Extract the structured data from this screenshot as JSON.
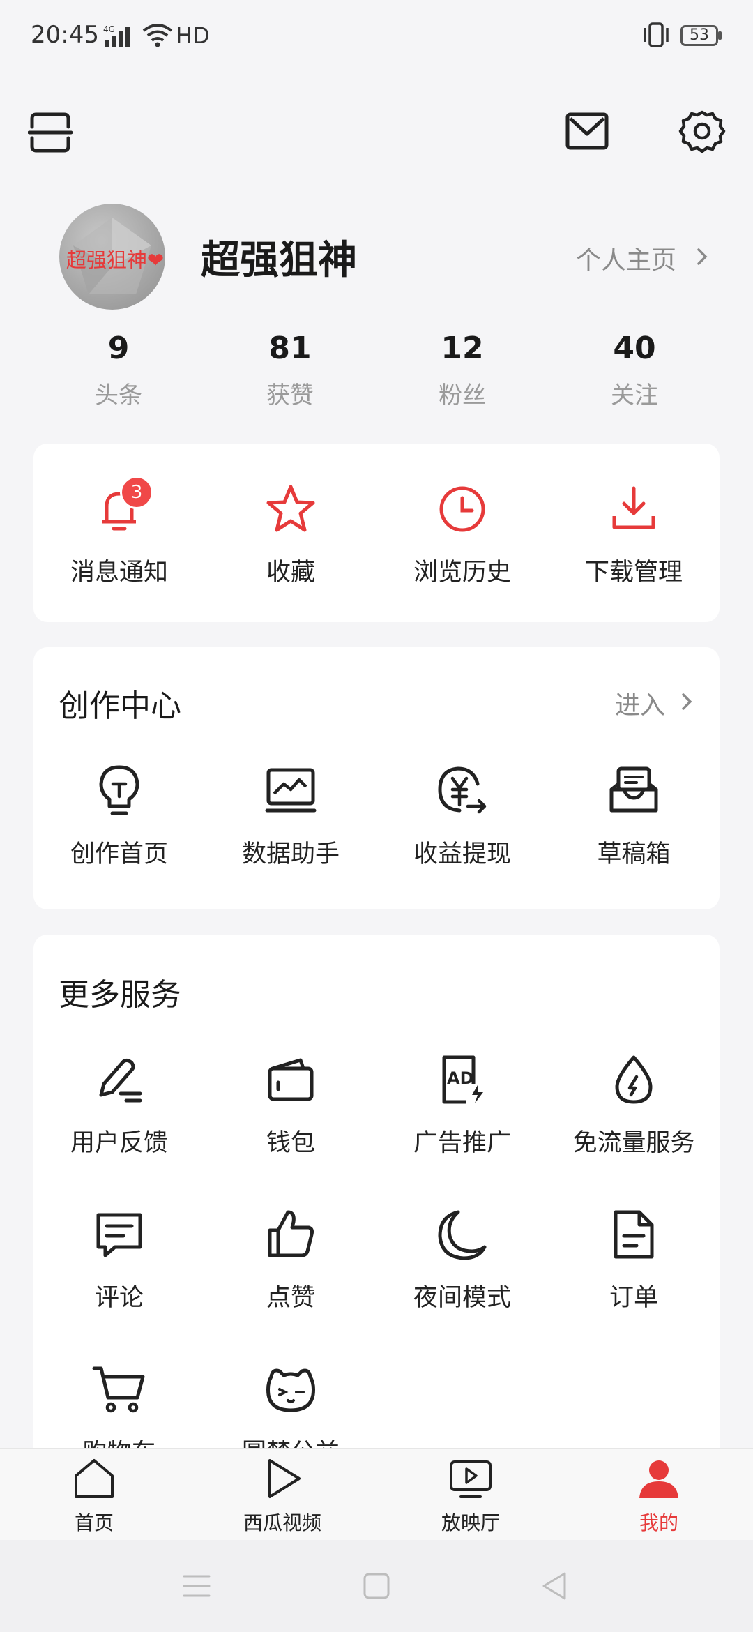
{
  "status_bar": {
    "time": "20:45",
    "network": "4G",
    "hd": "HD",
    "battery": "53"
  },
  "profile": {
    "avatar_text": "超强狙神❤",
    "username": "超强狙神",
    "homepage_link": "个人主页"
  },
  "stats": [
    {
      "value": "9",
      "label": "头条"
    },
    {
      "value": "81",
      "label": "获赞"
    },
    {
      "value": "12",
      "label": "粉丝"
    },
    {
      "value": "40",
      "label": "关注"
    }
  ],
  "quick_actions": [
    {
      "label": "消息通知",
      "icon": "bell-icon",
      "badge": "3"
    },
    {
      "label": "收藏",
      "icon": "star-icon"
    },
    {
      "label": "浏览历史",
      "icon": "clock-icon"
    },
    {
      "label": "下载管理",
      "icon": "download-icon"
    }
  ],
  "creation_center": {
    "title": "创作中心",
    "enter_label": "进入",
    "items": [
      {
        "label": "创作首页",
        "icon": "bulb-icon"
      },
      {
        "label": "数据助手",
        "icon": "chart-icon"
      },
      {
        "label": "收益提现",
        "icon": "yuan-icon"
      },
      {
        "label": "草稿箱",
        "icon": "inbox-icon"
      }
    ]
  },
  "more_services": {
    "title": "更多服务",
    "items": [
      {
        "label": "用户反馈",
        "icon": "pencil-icon"
      },
      {
        "label": "钱包",
        "icon": "wallet-icon"
      },
      {
        "label": "广告推广",
        "icon": "ad-icon"
      },
      {
        "label": "免流量服务",
        "icon": "drop-icon"
      },
      {
        "label": "评论",
        "icon": "comment-icon"
      },
      {
        "label": "点赞",
        "icon": "thumb-icon"
      },
      {
        "label": "夜间模式",
        "icon": "moon-icon"
      },
      {
        "label": "订单",
        "icon": "document-icon"
      },
      {
        "label": "购物车",
        "icon": "cart-icon"
      },
      {
        "label": "圆梦公益",
        "icon": "charity-icon"
      }
    ]
  },
  "bottom_nav": [
    {
      "label": "首页",
      "icon": "home-icon"
    },
    {
      "label": "西瓜视频",
      "icon": "play-icon"
    },
    {
      "label": "放映厅",
      "icon": "tv-icon"
    },
    {
      "label": "我的",
      "icon": "user-icon",
      "active": true
    }
  ],
  "colors": {
    "accent": "#e63a3a",
    "background": "#f5f5f7",
    "card": "#ffffff"
  }
}
